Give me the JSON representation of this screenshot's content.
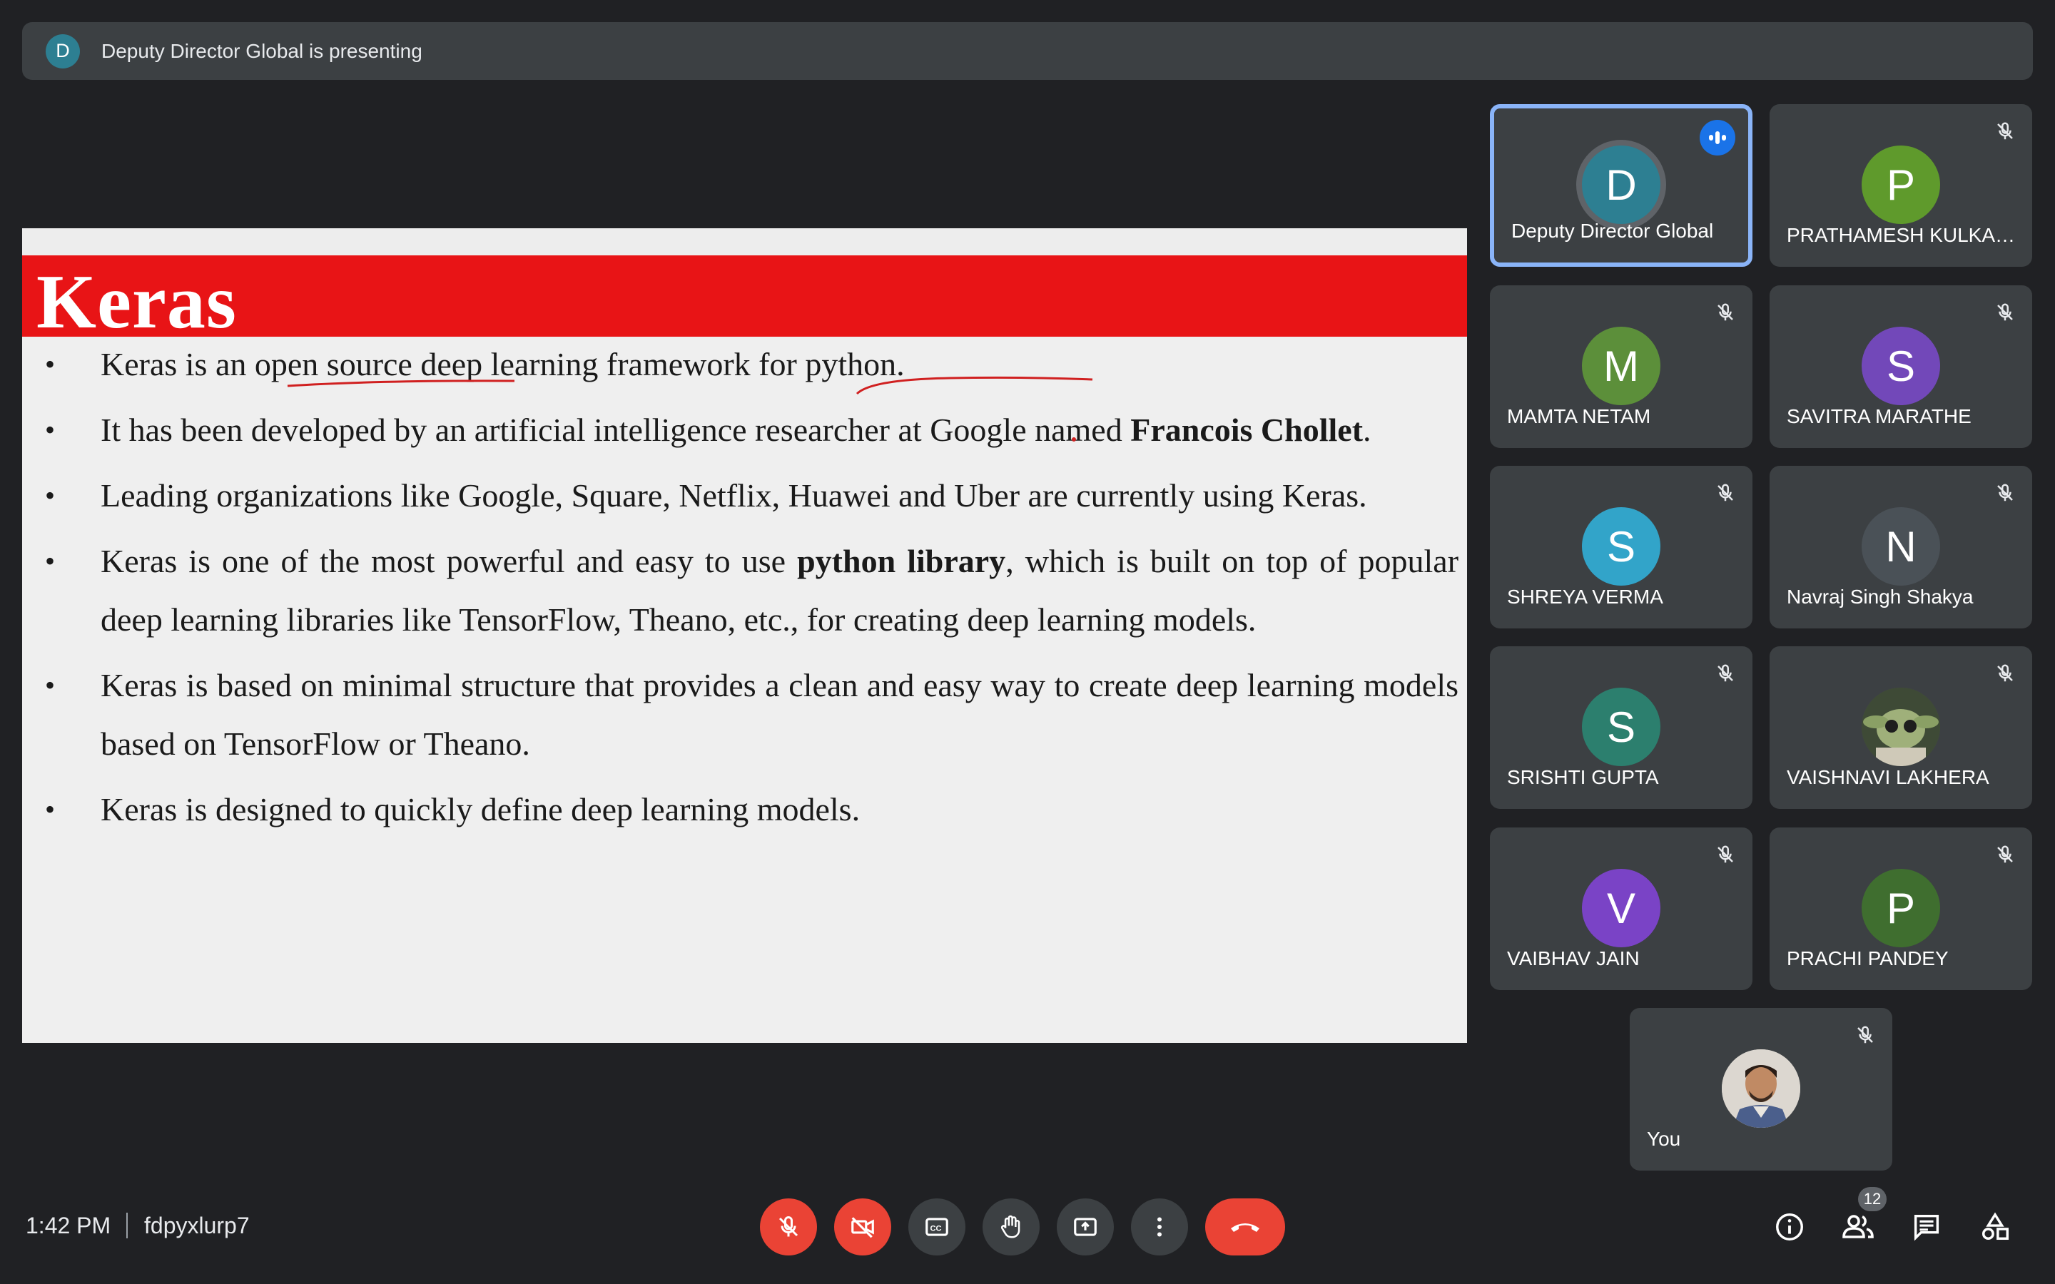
{
  "banner": {
    "avatar_letter": "D",
    "text": "Deputy Director Global is presenting"
  },
  "slide": {
    "title": "Keras",
    "bullets": [
      {
        "text": "Keras is an open source deep learning framework for python."
      },
      {
        "pre": "It has been developed by an artificial intelligence researcher at Google named ",
        "bold": "Francois Chollet",
        "post": "."
      },
      {
        "text": "Leading organizations like Google, Square, Netflix, Huawei and Uber are currently using Keras."
      },
      {
        "pre": "Keras is one of the most powerful and easy to use ",
        "bold": "python library",
        "post": ", which is built on top of popular deep learning libraries like TensorFlow, Theano, etc., for creating deep learning models."
      },
      {
        "text": "Keras is based on minimal structure that provides a clean and easy way to create deep learning models based on TensorFlow or Theano."
      },
      {
        "text": "Keras is designed to quickly define deep learning models."
      }
    ]
  },
  "participants": [
    {
      "letter": "D",
      "name": "Deputy Director Global",
      "color": "#2d7f92",
      "speaking": true
    },
    {
      "letter": "P",
      "name": "PRATHAMESH KULKAR...",
      "color": "#5f9a2c"
    },
    {
      "letter": "M",
      "name": "MAMTA NETAM",
      "color": "#5c8f3a"
    },
    {
      "letter": "S",
      "name": "SAVITRA MARATHE",
      "color": "#7248b9"
    },
    {
      "letter": "S",
      "name": "SHREYA VERMA",
      "color": "#32a4c9"
    },
    {
      "letter": "N",
      "name": "Navraj Singh Shakya",
      "color": "#4a5157"
    },
    {
      "letter": "S",
      "name": "SRISHTI GUPTA",
      "color": "#2c7f6e"
    },
    {
      "letter": "",
      "name": "VAISHNAVI LAKHERA",
      "color": "#4f5b44"
    },
    {
      "letter": "V",
      "name": "VAIBHAV JAIN",
      "color": "#7a43c6"
    },
    {
      "letter": "P",
      "name": "PRACHI PANDEY",
      "color": "#3f6e2f"
    },
    {
      "letter": "",
      "name": "You",
      "color": "#d9d4ce"
    }
  ],
  "bottom": {
    "time": "1:42 PM",
    "meeting_code": "fdpyxlurp7",
    "people_count": "12"
  }
}
